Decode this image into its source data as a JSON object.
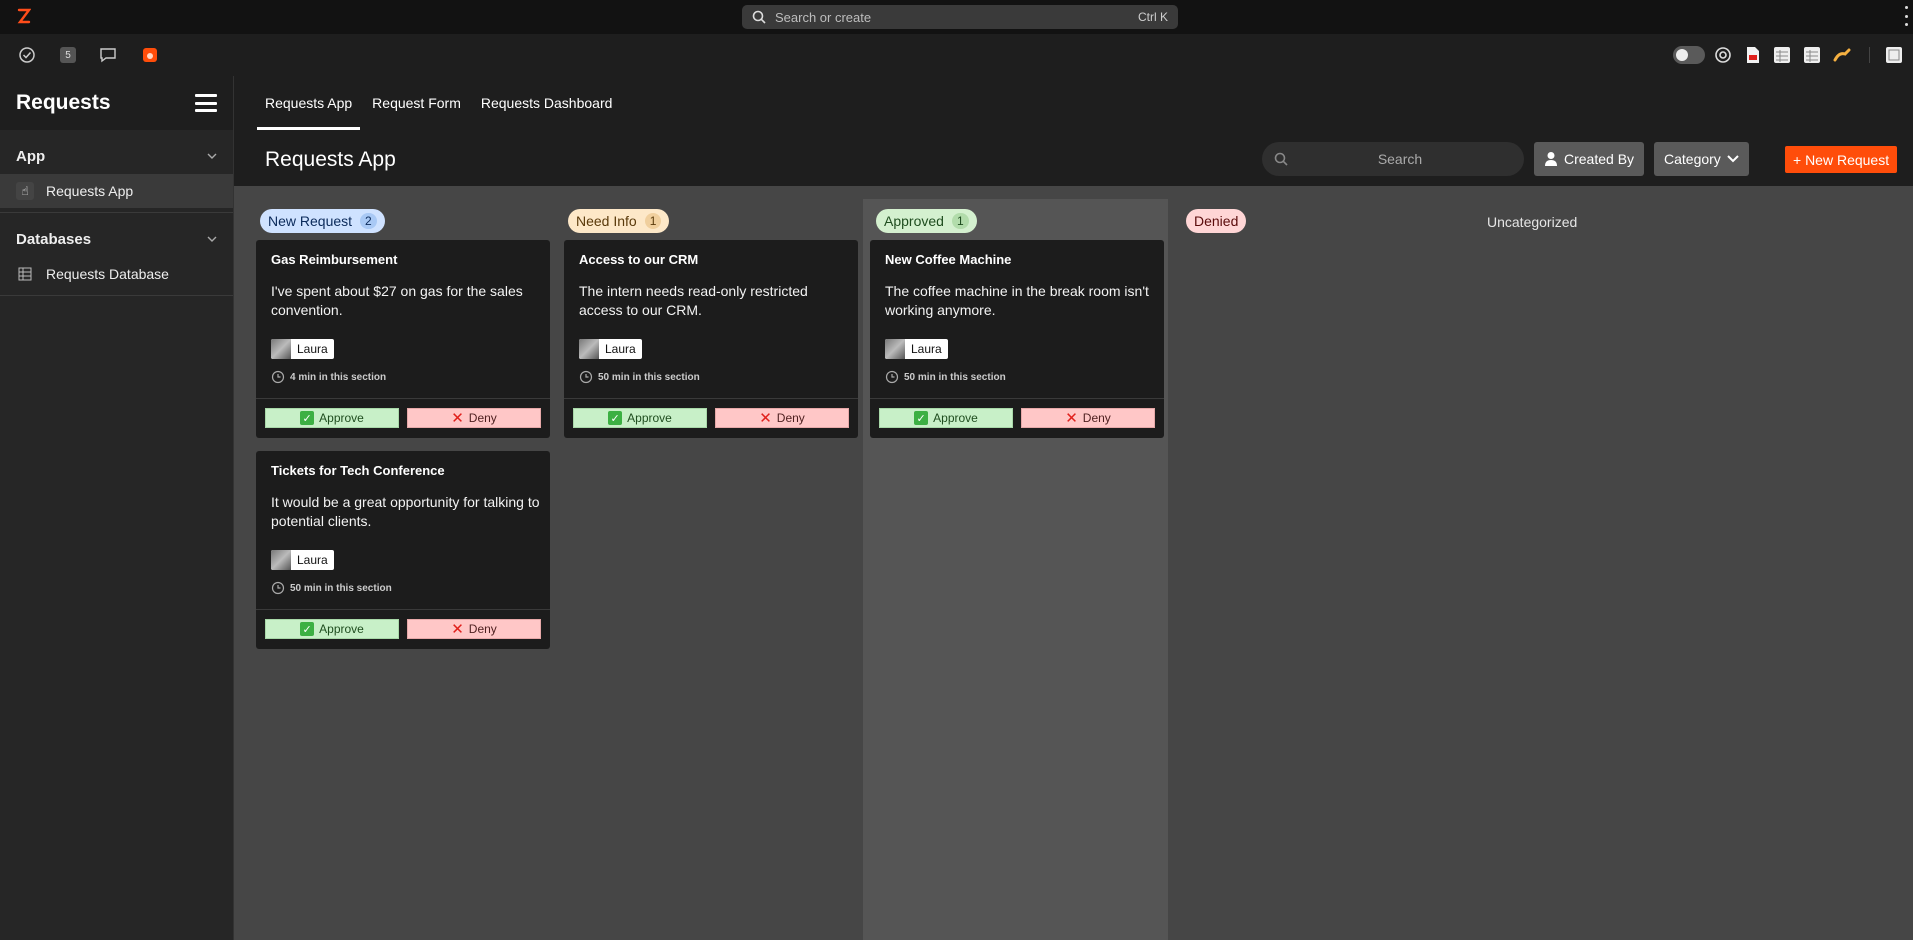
{
  "topbar": {
    "search_placeholder": "Search or create",
    "shortcut": "Ctrl K"
  },
  "toolbar": {
    "badge_count": "5"
  },
  "sidebar": {
    "title": "Requests",
    "sections": [
      {
        "label": "App",
        "items": [
          {
            "label": "Requests App",
            "icon": "pointing-hand-icon",
            "active": true
          }
        ]
      },
      {
        "label": "Databases",
        "items": [
          {
            "label": "Requests Database",
            "icon": "table-icon",
            "active": false
          }
        ]
      }
    ]
  },
  "tabs": [
    {
      "label": "Requests App",
      "active": true
    },
    {
      "label": "Request Form",
      "active": false
    },
    {
      "label": "Requests Dashboard",
      "active": false
    }
  ],
  "header": {
    "page_title": "Requests App",
    "search_placeholder": "Search",
    "created_by_label": "Created By",
    "category_label": "Category",
    "new_request_label": "+ New Request"
  },
  "columns": [
    {
      "label": "New Request",
      "count": "2",
      "bg": "#cfe2ff",
      "color": "#0b2a5a",
      "cnt_bg": "#a9c9f5",
      "cards": [
        {
          "title": "Gas Reimbursement",
          "desc": "I've spent about $27 on gas for the sales convention.",
          "user": "Laura",
          "time": "4 min in this section",
          "approve": "Approve",
          "deny": "Deny"
        },
        {
          "title": "Tickets for Tech Conference",
          "desc": "It would be a great opportunity for talking to potential clients.",
          "user": "Laura",
          "time": "50 min in this section",
          "approve": "Approve",
          "deny": "Deny"
        }
      ]
    },
    {
      "label": "Need Info",
      "count": "1",
      "bg": "#fde8c8",
      "color": "#5a3a0b",
      "cnt_bg": "#f0cf9d",
      "cards": [
        {
          "title": "Access to our CRM",
          "desc": "The intern needs read-only restricted access to our CRM.",
          "user": "Laura",
          "time": "50 min in this section",
          "approve": "Approve",
          "deny": "Deny"
        }
      ]
    },
    {
      "label": "Approved",
      "count": "1",
      "bg": "#d4f0cf",
      "color": "#1f4d1f",
      "cnt_bg": "#b2dcab",
      "cards": [
        {
          "title": "New Coffee Machine",
          "desc": "The coffee machine in the break room isn't working anymore.",
          "user": "Laura",
          "time": "50 min in this section",
          "approve": "Approve",
          "deny": "Deny"
        }
      ]
    },
    {
      "label": "Denied",
      "count": "",
      "bg": "#ffd6d6",
      "color": "#5a0b0b",
      "cnt_bg": "",
      "cards": []
    }
  ],
  "uncategorized_label": "Uncategorized",
  "colors": {
    "accent": "#ff4d0a",
    "board_bg": "#464646",
    "sidebar_bg": "#262626"
  }
}
